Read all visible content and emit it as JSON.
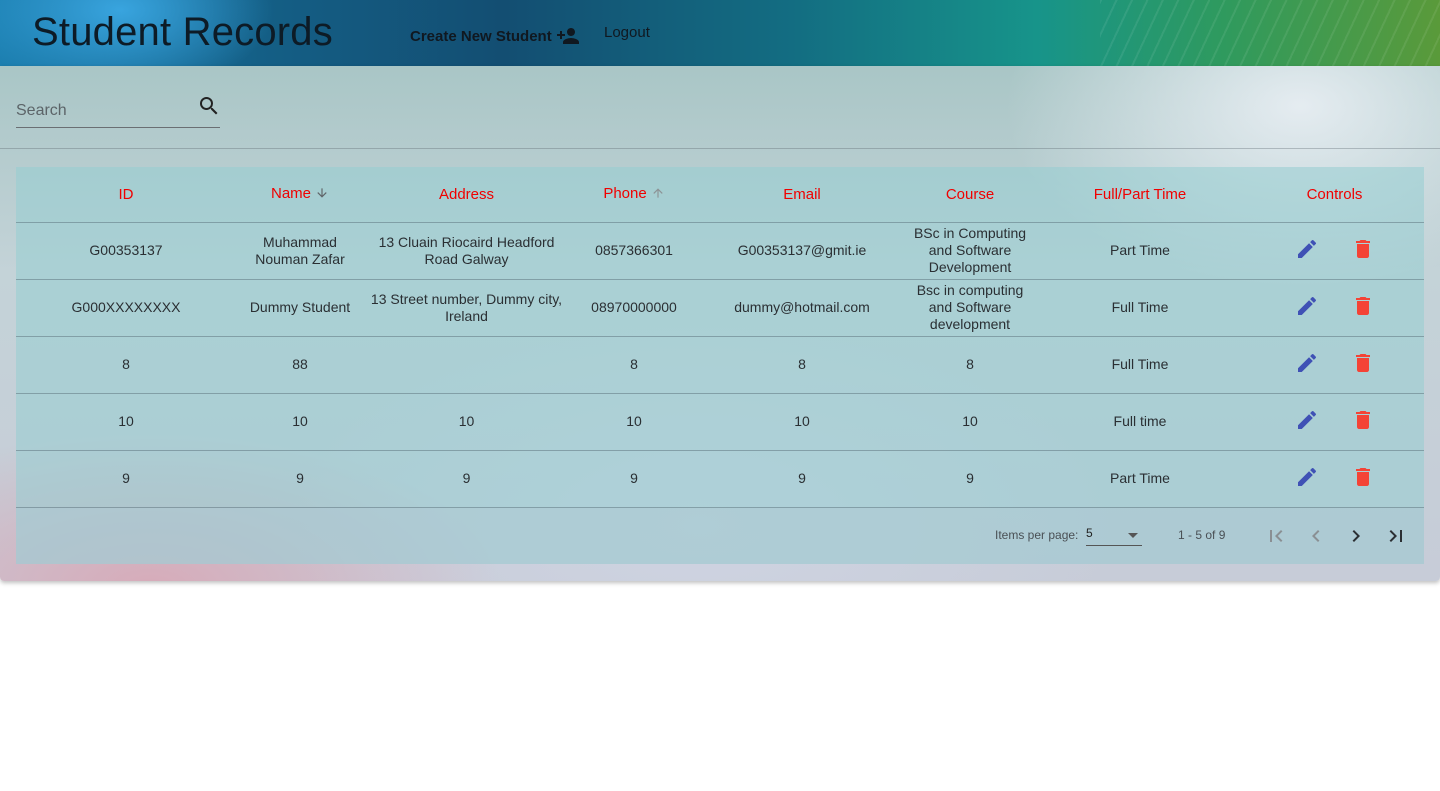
{
  "header": {
    "title": "Student Records",
    "create_label": "Create New Student",
    "logout_label": "Logout"
  },
  "search": {
    "placeholder": "Search",
    "value": ""
  },
  "table": {
    "columns": [
      "ID",
      "Name",
      "Address",
      "Phone",
      "Email",
      "Course",
      "Full/Part Time",
      "Controls"
    ],
    "sort": {
      "Name": "descending",
      "Phone": "ascending (inactive)"
    },
    "rows": [
      [
        "G00353137",
        "Muhammad Nouman Zafar",
        "13 Cluain Riocaird Headford Road Galway",
        "0857366301",
        "G00353137@gmit.ie",
        "BSc in Computing and Software Development",
        "Part Time"
      ],
      [
        "G000XXXXXXXX",
        "Dummy Student",
        "13 Street number, Dummy city, Ireland",
        "08970000000",
        "dummy@hotmail.com",
        "Bsc in computing and Software development",
        "Full Time"
      ],
      [
        "8",
        "88",
        "",
        "8",
        "8",
        "8",
        "Full Time"
      ],
      [
        "10",
        "10",
        "10",
        "10",
        "10",
        "10",
        "Full time"
      ],
      [
        "9",
        "9",
        "9",
        "9",
        "9",
        "9",
        "Part Time"
      ]
    ],
    "row_controls": [
      "edit-icon",
      "delete-icon"
    ]
  },
  "paginator": {
    "items_per_page_label": "Items per page:",
    "page_size": "5",
    "range_label": "1 - 5 of 9"
  },
  "colors": {
    "header_text": "#f00000",
    "edit_icon": "#3f51b5",
    "delete_icon": "#f44336"
  }
}
